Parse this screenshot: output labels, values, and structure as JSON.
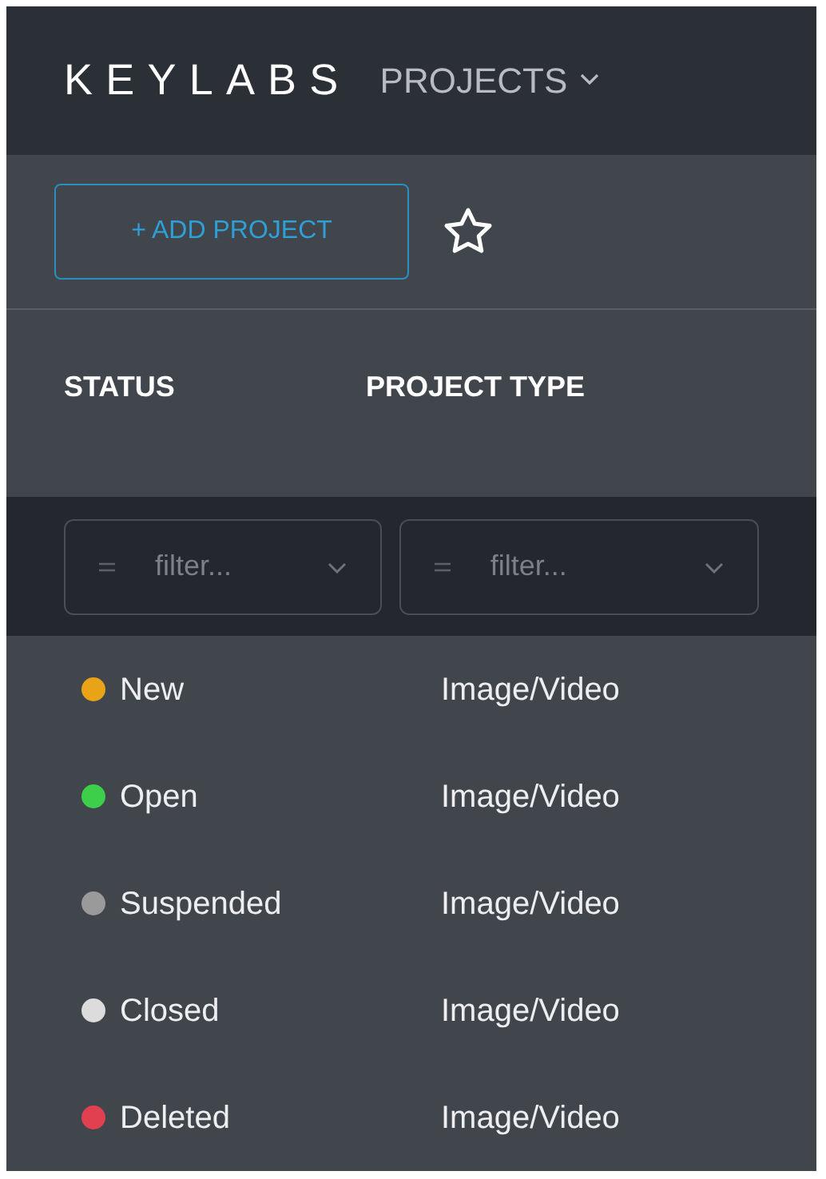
{
  "header": {
    "logo": "KEYLABS",
    "menu": "PROJECTS"
  },
  "toolbar": {
    "add_button": "+ ADD PROJECT"
  },
  "table": {
    "columns": [
      "STATUS",
      "PROJECT TYPE"
    ],
    "filters": [
      {
        "placeholder": "filter..."
      },
      {
        "placeholder": "filter..."
      }
    ],
    "rows": [
      {
        "status": "New",
        "color": "#e8a317",
        "type": "Image/Video"
      },
      {
        "status": "Open",
        "color": "#3ecf4a",
        "type": "Image/Video"
      },
      {
        "status": "Suspended",
        "color": "#9a9a9a",
        "type": "Image/Video"
      },
      {
        "status": "Closed",
        "color": "#dcdcdc",
        "type": "Image/Video"
      },
      {
        "status": "Deleted",
        "color": "#e0404f",
        "type": "Image/Video"
      }
    ]
  }
}
